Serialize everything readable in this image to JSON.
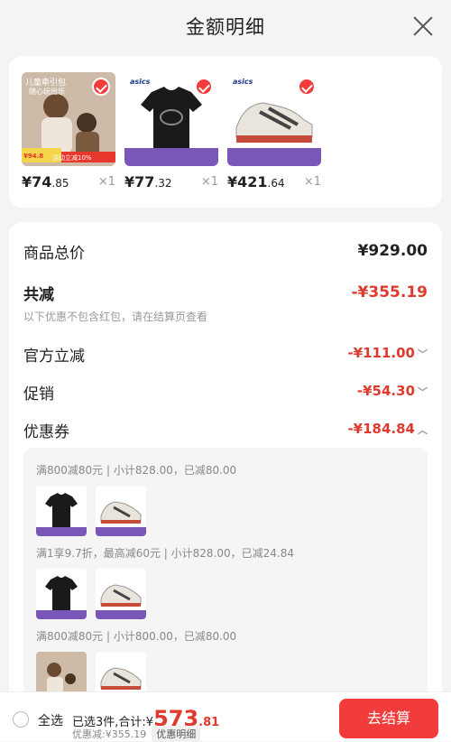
{
  "header": {
    "title": "金额明细"
  },
  "goods": [
    {
      "price_int": "¥74",
      "price_dec": ".85",
      "qty": "×1",
      "badge_text": "儿童牵引包",
      "sub_text": "随心玩出乐",
      "tag": "活动立减10%",
      "tag2": "¥94.8"
    },
    {
      "price_int": "¥77",
      "price_dec": ".32",
      "qty": "×1",
      "brand": "asics"
    },
    {
      "price_int": "¥421",
      "price_dec": ".64",
      "qty": "×1",
      "brand": "asics"
    }
  ],
  "detail": {
    "total_label": "商品总价",
    "total_value": "¥929.00",
    "discount_label": "共减",
    "discount_value": "-¥355.19",
    "note": "以下优惠不包含红包，请在结算页查看",
    "official_label": "官方立减",
    "official_value": "-¥111.00",
    "promo_label": "促销",
    "promo_value": "-¥54.30",
    "coupon_label": "优惠券",
    "coupon_value": "-¥184.84"
  },
  "coupons": [
    {
      "title": "满800减80元 | 小计828.00，已减80.00"
    },
    {
      "title": "满1享9.7折，最高减60元 | 小计828.00，已减24.84"
    },
    {
      "title": "满800减80元 | 小计800.00，已减80.00"
    }
  ],
  "bottom": {
    "select_all": "全选",
    "summary_prefix": "已选3件,合计:¥",
    "summary_int": "573",
    "summary_dec": ".81",
    "saved": "优惠减:¥355.19",
    "detail_tag": "优惠明细",
    "checkout": "去结算"
  }
}
